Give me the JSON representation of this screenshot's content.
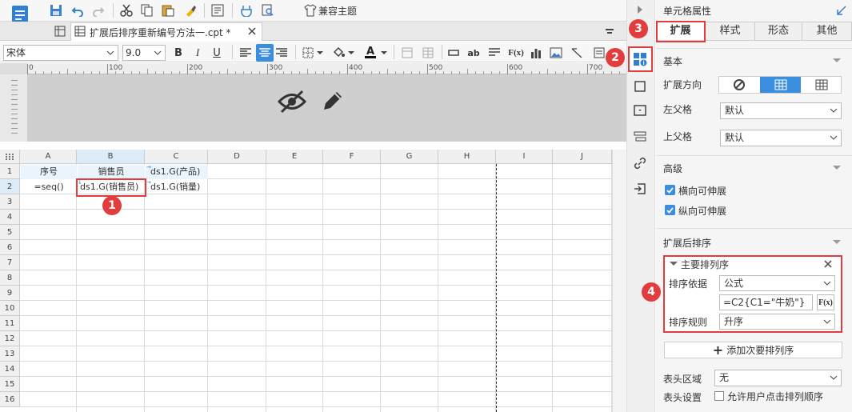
{
  "toolbar": {
    "theme_label": "兼容主题"
  },
  "file_tab": {
    "title": "扩展后排序重新编号方法一.cpt *"
  },
  "format_bar": {
    "font_name": "宋体",
    "font_size": "9.0",
    "bold": "B",
    "italic": "I",
    "underline": "U",
    "text_label": "ab",
    "fx_label": "F(x)"
  },
  "ruler": {
    "ticks": [
      "0",
      "100",
      "200",
      "300",
      "400",
      "500",
      "600",
      "700"
    ]
  },
  "sheet": {
    "columns": [
      "A",
      "B",
      "C",
      "D",
      "E",
      "F",
      "G",
      "H",
      "I",
      "J"
    ],
    "rows": [
      "1",
      "2",
      "3",
      "4",
      "5",
      "6",
      "7",
      "8",
      "9",
      "10",
      "11",
      "12",
      "13",
      "14",
      "15",
      "16"
    ],
    "cells": {
      "A1": "序号",
      "B1": "销售员",
      "C1": "ds1.G(产品)",
      "A2": "=seq()",
      "B2": "ds1.G(销售员)",
      "C2": "ds1.G(销量)"
    }
  },
  "panel": {
    "title": "单元格属性",
    "tabs": [
      "扩展",
      "样式",
      "形态",
      "其他"
    ],
    "basic": {
      "title": "基本",
      "direction_label": "扩展方向",
      "left_parent_label": "左父格",
      "left_parent_value": "默认",
      "top_parent_label": "上父格",
      "top_parent_value": "默认"
    },
    "advanced": {
      "title": "高级",
      "horizontal_label": "横向可伸展",
      "vertical_label": "纵向可伸展"
    },
    "sort": {
      "title": "扩展后排序",
      "primary_title": "主要排列序",
      "basis_label": "排序依据",
      "basis_value": "公式",
      "formula_value": "=C2{C1=\"牛奶\"}",
      "fx_label": "F(x)",
      "rule_label": "排序规则",
      "rule_value": "升序",
      "add_secondary_label": "添加次要排列序"
    },
    "header_area_label": "表头区域",
    "header_area_value": "无",
    "header_setting_label": "表头设置",
    "allow_user_sort_label": "允许用户点击排列顺序"
  },
  "badges": [
    "1",
    "2",
    "3",
    "4"
  ],
  "colors": {
    "accent": "#3b8ddd",
    "badge": "#e23c3c",
    "panel_bg": "#f5f5f5"
  }
}
